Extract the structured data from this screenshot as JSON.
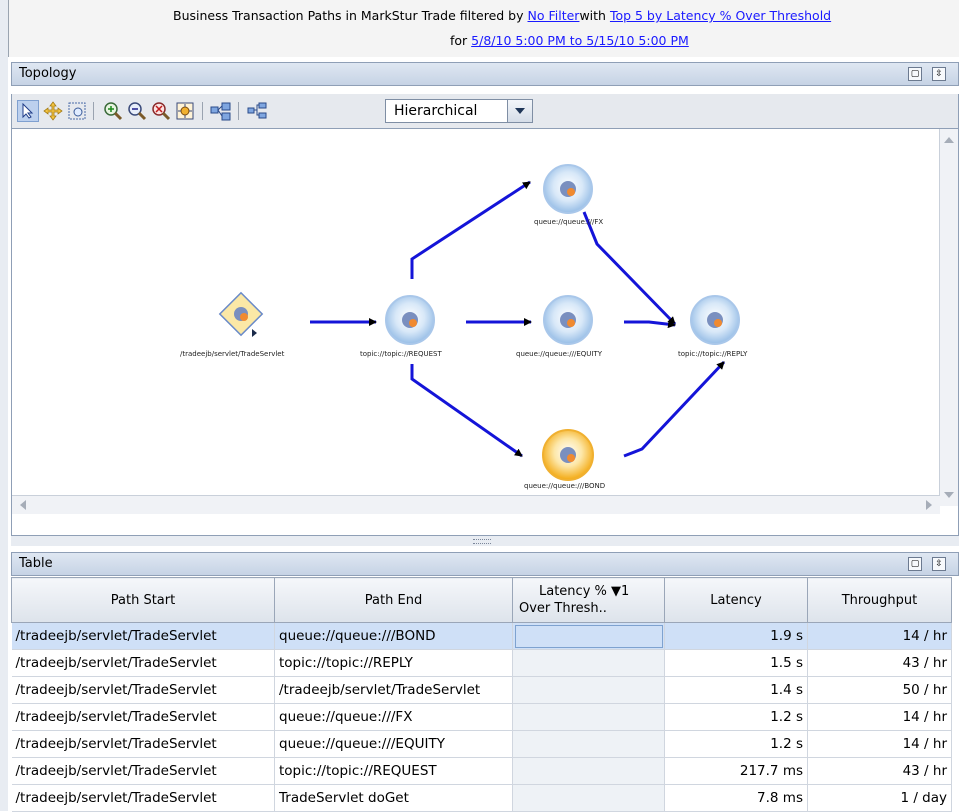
{
  "header": {
    "line1_prefix": "Business Transaction Paths in MarkStur Trade filtered by ",
    "filter_link": "No Filter",
    "line1_mid": "with ",
    "top_link": "Top 5 by Latency % Over Threshold",
    "line2_prefix": "for ",
    "range_link": "5/8/10 5:00 PM to 5/15/10 5:00 PM"
  },
  "topology": {
    "title": "Topology",
    "layout_value": "Hierarchical",
    "nodes": {
      "servlet": "/tradeejb/servlet/TradeServlet",
      "request": "topic://topic://REQUEST",
      "fx": "queue://queue:///FX",
      "equity": "queue://queue:///EQUITY",
      "bond": "queue://queue:///BOND",
      "reply": "topic://topic://REPLY"
    }
  },
  "table": {
    "title": "Table",
    "columns": {
      "path_start": "Path Start",
      "path_end": "Path End",
      "latency_pct_line1": "Latency %",
      "latency_pct_sort": "1",
      "latency_pct_line2": "Over Thresh..",
      "latency": "Latency",
      "throughput": "Throughput"
    },
    "rows": [
      {
        "start": "/tradeejb/servlet/TradeServlet",
        "end": "queue://queue:///BOND",
        "latency": "1.9 s",
        "throughput": "14 / hr"
      },
      {
        "start": "/tradeejb/servlet/TradeServlet",
        "end": "topic://topic://REPLY",
        "latency": "1.5 s",
        "throughput": "43 / hr"
      },
      {
        "start": "/tradeejb/servlet/TradeServlet",
        "end": "/tradeejb/servlet/TradeServlet",
        "latency": "1.4 s",
        "throughput": "50 / hr"
      },
      {
        "start": "/tradeejb/servlet/TradeServlet",
        "end": "queue://queue:///FX",
        "latency": "1.2 s",
        "throughput": "14 / hr"
      },
      {
        "start": "/tradeejb/servlet/TradeServlet",
        "end": "queue://queue:///EQUITY",
        "latency": "1.2 s",
        "throughput": "14 / hr"
      },
      {
        "start": "/tradeejb/servlet/TradeServlet",
        "end": "topic://topic://REQUEST",
        "latency": "217.7 ms",
        "throughput": "43 / hr"
      },
      {
        "start": "/tradeejb/servlet/TradeServlet",
        "end": "TradeServlet doGet",
        "latency": "7.8 ms",
        "throughput": "1 / day"
      }
    ]
  },
  "colors": {
    "edge": "#1414d8",
    "node_blue": "#a8c8ec",
    "node_highlight": "#f6b31c",
    "link": "#1a1aff",
    "selection": "#cfe0f7"
  }
}
